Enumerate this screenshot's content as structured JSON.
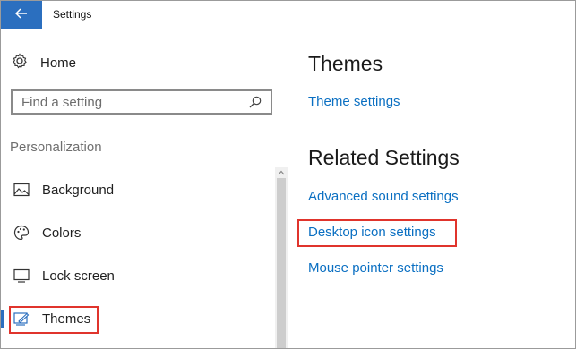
{
  "window": {
    "title": "Settings",
    "back_icon": "arrow-left-icon"
  },
  "sidebar": {
    "home_label": "Home",
    "search": {
      "placeholder": "Find a setting"
    },
    "section_header": "Personalization",
    "items": [
      {
        "label": "Background",
        "icon": "picture-icon"
      },
      {
        "label": "Colors",
        "icon": "palette-icon"
      },
      {
        "label": "Lock screen",
        "icon": "lock-screen-icon"
      },
      {
        "label": "Themes",
        "icon": "themes-icon",
        "selected": true
      }
    ]
  },
  "main": {
    "title": "Themes",
    "theme_settings_link": "Theme settings",
    "related_title": "Related Settings",
    "related_links": [
      "Advanced sound settings",
      "Desktop icon settings",
      "Mouse pointer settings"
    ]
  },
  "colors": {
    "accent": "#2b6fbf",
    "link": "#0a6fc2",
    "highlight": "#e0342c"
  }
}
